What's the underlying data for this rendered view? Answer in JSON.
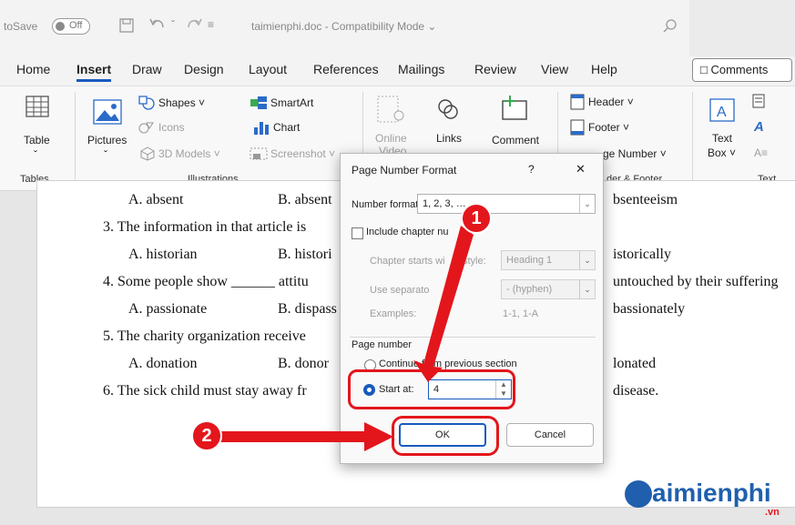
{
  "titlebar": {
    "autosave": "toSave",
    "toggle": "Off",
    "doc_title": "taimienphi.doc - Compatibility Mode ⌄"
  },
  "tabs": [
    "Home",
    "Insert",
    "Draw",
    "Design",
    "Layout",
    "References",
    "Mailings",
    "Review",
    "View",
    "Help"
  ],
  "comments_label": "Comments",
  "ribbon": {
    "table": "Table",
    "pictures": "Pictures",
    "shapes": "Shapes ˅",
    "icons": "Icons",
    "models": "3D Models ˅",
    "smartart": "SmartArt",
    "chart": "Chart",
    "screenshot": "Screenshot ˅",
    "online": "Online",
    "online2": "Video",
    "links": "Links",
    "comment": "Comment",
    "header": "Header ˅",
    "footer": "Footer ˅",
    "page_number": "ge Number ˅",
    "textbox1": "Text",
    "textbox2": "Box ˅",
    "groups": {
      "tables": "Tables",
      "illustrations": "Illustrations",
      "header_footer": "der & Footer",
      "text": "Text"
    }
  },
  "doc": {
    "lines": [
      {
        "a": "A. absent",
        "b": "B. absent",
        "d": "bsenteeism"
      },
      {
        "q": "3.  The information in that article is",
        "tail": ""
      },
      {
        "a": "A. historian",
        "b": "B. histori",
        "d": "istorically"
      },
      {
        "q": "4.  Some people show ______ attitu",
        "tail": "untouched by their suffering"
      },
      {
        "a": "A. passionate",
        "b": "B. dispass",
        "d": "bassionately"
      },
      {
        "q": "5.  The charity organization receive",
        "tail": ""
      },
      {
        "a": "A. donation",
        "b": "B. donor",
        "d": "lonated"
      },
      {
        "q": "6.  The sick child must stay away fr",
        "tail": "disease."
      }
    ]
  },
  "dialog": {
    "title": "Page Number Format",
    "help": "?",
    "close": "✕",
    "number_format_label": "Number format:",
    "number_format_value": "1, 2, 3, …",
    "include_chapter": "Include chapter nu",
    "chapter_starts": "Chapter starts wi",
    "chapter_style_suffix": "style:",
    "chapter_style_value": "Heading 1",
    "use_separator": "Use separato",
    "separator_value": "-  (hyphen)",
    "examples_label": "Examples:",
    "examples_value": "1-1, 1-A",
    "page_numbering": "Page number",
    "continue_label": "Continue from previous section",
    "start_at_label": "Start at:",
    "start_at_value": "4",
    "ok": "OK",
    "cancel": "Cancel"
  },
  "annotations": {
    "badge1": "1",
    "badge2": "2"
  },
  "watermark": {
    "brand": "aimienphi",
    "suffix": ".vn"
  },
  "colors": {
    "accent": "#185abd",
    "annotation": "#e3161c"
  }
}
